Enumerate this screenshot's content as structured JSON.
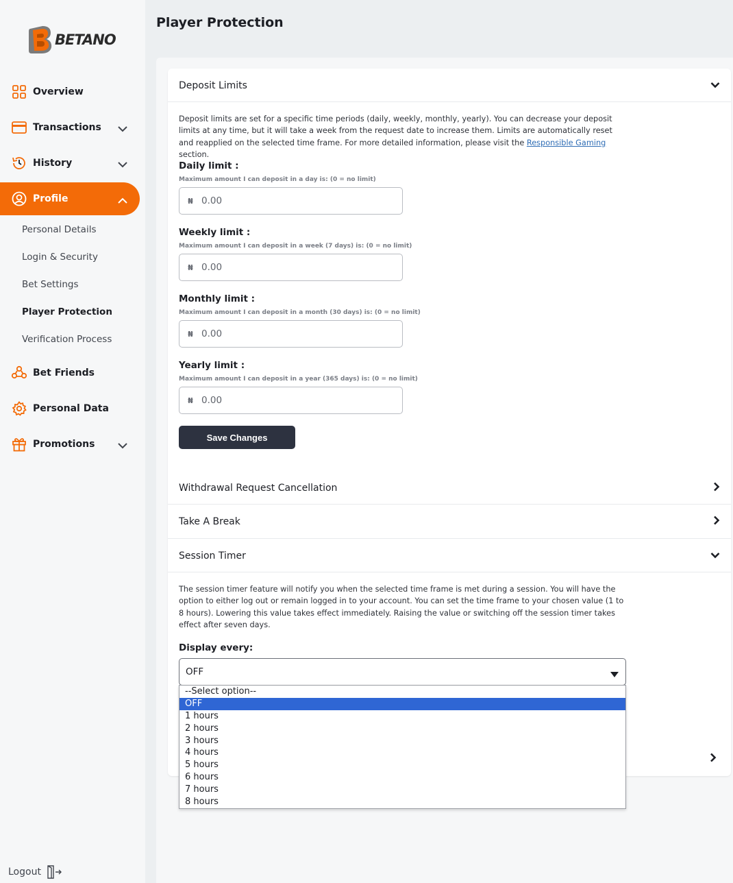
{
  "brand": {
    "name": "BETANO",
    "accent_color": "#f36b08"
  },
  "sidebar": {
    "items": [
      {
        "label": "Overview",
        "icon": "grid-icon"
      },
      {
        "label": "Transactions",
        "icon": "card-icon"
      },
      {
        "label": "History",
        "icon": "history-icon"
      },
      {
        "label": "Profile",
        "icon": "user-circle-icon"
      },
      {
        "label": "Bet Friends",
        "icon": "friends-icon"
      },
      {
        "label": "Personal Data",
        "icon": "gear-icon"
      },
      {
        "label": "Promotions",
        "icon": "gift-icon"
      }
    ],
    "profile_sub": [
      {
        "label": "Personal Details"
      },
      {
        "label": "Login & Security"
      },
      {
        "label": "Bet Settings"
      },
      {
        "label": "Player Protection"
      },
      {
        "label": "Verification Process"
      }
    ],
    "logout_label": "Logout"
  },
  "page": {
    "title": "Player Protection"
  },
  "deposit": {
    "header": "Deposit Limits",
    "desc_before_link": "Deposit limits are set for a specific time periods (daily, weekly, monthly, yearly). You can decrease your deposit limits at any time, but it will take a week from the request date to increase them. Limits are automatically reset and reapplied on the selected time frame. For more detailed information, please visit the ",
    "desc_link": "Responsible Gaming",
    "desc_after_link": " section.",
    "currency_symbol": "₦",
    "limits": [
      {
        "label": "Daily limit :",
        "help": "Maximum amount I can deposit in a day is: (0 = no limit)",
        "value": "0.00"
      },
      {
        "label": "Weekly limit :",
        "help": "Maximum amount I can deposit in a week (7 days) is: (0 = no limit)",
        "value": "0.00"
      },
      {
        "label": "Monthly limit :",
        "help": "Maximum amount I can deposit in a month (30 days) is: (0 = no limit)",
        "value": "0.00"
      },
      {
        "label": "Yearly limit :",
        "help": "Maximum amount I can deposit in a year (365 days) is: (0 = no limit)",
        "value": "0.00"
      }
    ],
    "save_label": "Save Changes"
  },
  "sections": {
    "withdrawal": "Withdrawal Request Cancellation",
    "take_break": "Take A Break",
    "session_timer": "Session Timer"
  },
  "session": {
    "desc": "The session timer feature will notify you when the selected time frame is met during a session. You will have the option to either log out or remain logged in to your account. You can set the time frame to your chosen value (1 to 8 hours). Lowering this value takes effect immediately. Raising the value or switching off the session timer takes effect after seven days.",
    "display_label": "Display every:",
    "selected": "OFF",
    "options": [
      "--Select option--",
      "OFF",
      "1 hours",
      "2 hours",
      "3 hours",
      "4 hours",
      "5 hours",
      "6 hours",
      "7 hours",
      "8 hours"
    ]
  }
}
